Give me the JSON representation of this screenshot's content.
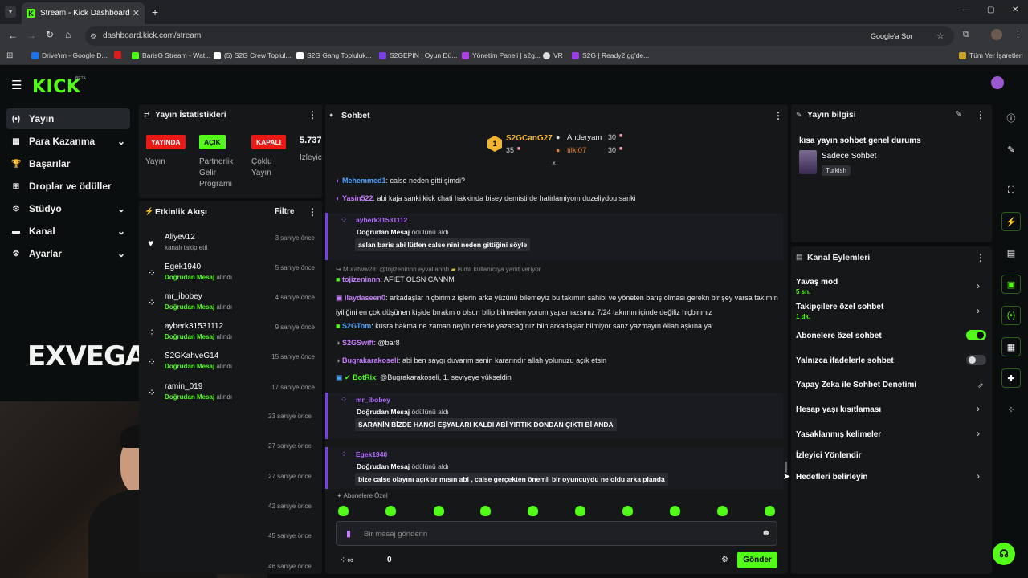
{
  "browser": {
    "tab_title": "Stream - Kick Dashboard",
    "tab_close": "✕",
    "new_tab": "+",
    "url": "dashboard.kick.com/stream",
    "google_label": "Google'a Sor",
    "bookmarks": [
      "Drive'ım - Google D...",
      "BarisG Stream - Wat...",
      "(5) S2G Crew Toplul...",
      "S2G Gang Topluluk...",
      "S2GEPIN | Oyun Dü...",
      "Yönetim Paneli | s2g...",
      "VR",
      "S2G | Ready2.gg'de..."
    ],
    "all_bookmarks": "Tüm Yer İşaretleri"
  },
  "kick": {
    "logo": "KICK",
    "beta": "BETA"
  },
  "nav": {
    "items": [
      {
        "label": "Yayın",
        "icon": "(•)"
      },
      {
        "label": "Para Kazanma",
        "icon": "▦"
      },
      {
        "label": "Başarılar",
        "icon": "🏆"
      },
      {
        "label": "Droplar ve ödüller",
        "icon": "⊞"
      },
      {
        "label": "Stüdyo",
        "icon": "⚙"
      },
      {
        "label": "Kanal",
        "icon": "▬"
      },
      {
        "label": "Ayarlar",
        "icon": "⚙"
      }
    ]
  },
  "webcam": {
    "watermark": "EXVEGA"
  },
  "stats": {
    "title": "Yayın İstatistikleri",
    "live_badge": "YAYINDA",
    "live_label": "Yayın",
    "partner_badge": "AÇIK",
    "partner_label": "Partnerlik Gelir Programı",
    "multi_badge": "KAPALI",
    "multi_label": "Çoklu Yayın",
    "viewers_value": "5.737",
    "viewers_label": "İzleyic"
  },
  "activity": {
    "title": "Etkinlik Akışı",
    "filter": "Filtre",
    "items": [
      {
        "name": "Aliyev12",
        "sub": "kanalı takip etti",
        "highlight": "",
        "time": "3 saniye önce"
      },
      {
        "name": "Egek1940",
        "sub": "alındı",
        "highlight": "Doğrudan Mesaj",
        "time": "5 saniye önce"
      },
      {
        "name": "mr_ibobey",
        "sub": "alındı",
        "highlight": "Doğrudan Mesaj",
        "time": "4 saniye önce"
      },
      {
        "name": "ayberk31531112",
        "sub": "alındı",
        "highlight": "Doğrudan Mesaj",
        "time": "9 saniye önce"
      },
      {
        "name": "S2GKahveG14",
        "sub": "alındı",
        "highlight": "Doğrudan Mesaj",
        "time": "15 saniye önce"
      },
      {
        "name": "ramin_019",
        "sub": "alındı",
        "highlight": "Doğrudan Mesaj",
        "time": "17 saniye önce"
      }
    ],
    "hidden_times": [
      "23 saniye önce",
      "27 saniye önce",
      "27 saniye önce",
      "42 saniye önce",
      "45 saniye önce",
      "46 saniye önce"
    ]
  },
  "chat": {
    "title": "Sohbet",
    "leaderboard": [
      {
        "name": "S2GCanG27",
        "count": "35",
        "rank": "1"
      },
      {
        "name": "Anderyam",
        "count": "30"
      },
      {
        "name": "tilki07",
        "count": "30"
      }
    ],
    "messages": [
      {
        "user": "Mehemmed1",
        "text": ": calse neden gitti şimdi?",
        "color": "#4aa3ff"
      },
      {
        "user": "Yasin522",
        "text": ": abi kaja sanki kick chati hakkinda bisey demisti de hatirlamiyom duzeliydou sanki",
        "color": "#c77dff"
      }
    ],
    "dm1": {
      "user": "ayberk31531112",
      "title": "Doğrudan Mesaj",
      "suffix": "ödülünü aldı",
      "message": "aslan baris abi lütfen calse nini neden gittiğini söyle"
    },
    "reply_context": "Muratww28: @tojizeninnn eyvallahhh",
    "reply_note": "isimli kullanıcıya yanıt veriyor",
    "msg3": {
      "user": "tojizeninnn",
      "text": ": AFIET OLSN CANNM",
      "color": "#53fc18"
    },
    "msg4": {
      "user": "ilaydaseen0",
      "text": ": arkadaşlar hiçbirimiz işlerin arka yüzünü bilemeyiz bu takımın sahibi ve yöneten barış olması gerekn bir şey varsa takımın iyiliğini en çok düşünen kişide bırakın o olsun bilip bilmeden yorum yapamazsınız 7/24 takımın içinde değiliz hiçbirimiz",
      "color": "#c77dff"
    },
    "msg5": {
      "user": "S2GTom",
      "text": ": kusra bakma ne zaman neyin nerede yazacağınız biln arkadaşlar bilmiyor sanz yazmayın Allah aşkına ya",
      "color": "#4aa3ff"
    },
    "msg6": {
      "user": "S2GSwift",
      "text": ": @bar8",
      "color": "#c77dff"
    },
    "msg7": {
      "user": "Bugrakarakoseli",
      "text": ": abi ben saygı duvarım senin kararındır allah yolunuzu açık etsin",
      "color": "#c77dff"
    },
    "msg8": {
      "user": "BotRix",
      "text": ": @Bugrakarakoseli, 1. seviyeye yükseldin",
      "color": "#53fc18"
    },
    "dm2": {
      "user": "mr_ibobey",
      "title": "Doğrudan Mesaj",
      "suffix": "ödülünü aldı",
      "message": "SARANİN BİZDE HANGİ EŞYALARI KALDI ABİ YIRTIK DONDAN ÇIKTI Bİ ANDA"
    },
    "dm3": {
      "user": "Egek1940",
      "title": "Doğrudan Mesaj",
      "suffix": "ödülünü aldı",
      "message": "bize calse olayını açıklar mısın abi , calse gerçekten önemli bir oyuncuydu ne oldu arka planda"
    },
    "subs_only": "Abonelere Özel",
    "input_placeholder": "Bir mesaj gönderin",
    "points": "0",
    "send": "Gönder"
  },
  "stream_info": {
    "title": "Yayın bilgisi",
    "stream_title": "kısa yayın sohbet genel durums",
    "category": "Sadece Sohbet",
    "language": "Turkish"
  },
  "channel_actions": {
    "title": "Kanal Eylemleri",
    "slow_mode": "Yavaş mod",
    "slow_value": "5 sn.",
    "followers_chat": "Takipçilere özel sohbet",
    "followers_value": "1 dk.",
    "subs_chat": "Abonelere özel sohbet",
    "emote_chat": "Yalnızca ifadelerle sohbet",
    "ai_mod": "Yapay Zeka ile Sohbet Denetimi",
    "account_age": "Hesap yaşı kısıtlaması",
    "banned_words": "Yasaklanmış kelimeler",
    "viewer_redirect": "İzleyici Yönlendir",
    "set_goals": "Hedefleri belirleyin",
    "subs_chat_on": true,
    "emote_chat_on": false
  },
  "colors": {
    "accent": "#53fc18",
    "live": "#e91916",
    "dm_purple": "#7b3fe4"
  }
}
